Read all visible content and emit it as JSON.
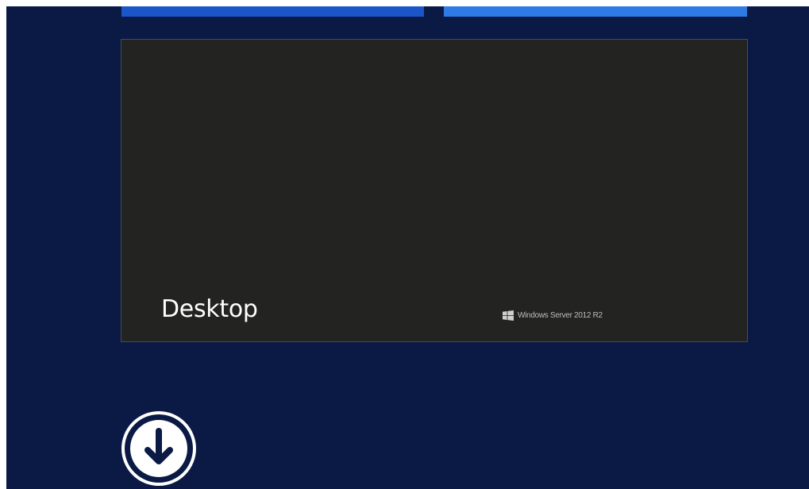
{
  "start_screen": {
    "background_color": "#0a1a45",
    "tiles": {
      "top_left": {
        "color": "#1a56c8"
      },
      "top_right": {
        "color": "#2e7be6"
      },
      "desktop": {
        "label": "Desktop",
        "background_color": "#232322",
        "branding": {
          "icon": "windows-logo-icon",
          "text": "Windows Server 2012 R2"
        }
      }
    },
    "apps_button": {
      "icon": "arrow-down-circle-icon"
    }
  }
}
